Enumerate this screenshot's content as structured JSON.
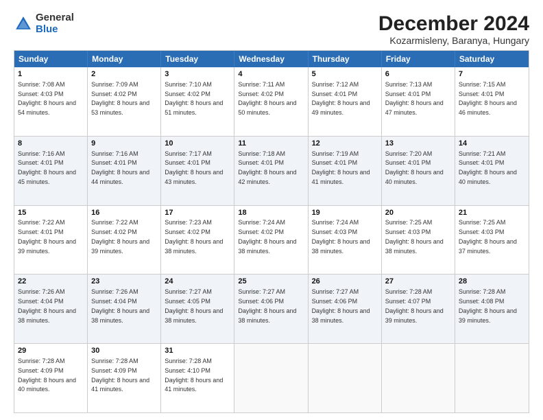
{
  "header": {
    "logo_general": "General",
    "logo_blue": "Blue",
    "title": "December 2024",
    "subtitle": "Kozarmisleny, Baranya, Hungary"
  },
  "days": [
    "Sunday",
    "Monday",
    "Tuesday",
    "Wednesday",
    "Thursday",
    "Friday",
    "Saturday"
  ],
  "rows": [
    [
      {
        "day": "1",
        "sunrise": "Sunrise: 7:08 AM",
        "sunset": "Sunset: 4:03 PM",
        "daylight": "Daylight: 8 hours and 54 minutes."
      },
      {
        "day": "2",
        "sunrise": "Sunrise: 7:09 AM",
        "sunset": "Sunset: 4:02 PM",
        "daylight": "Daylight: 8 hours and 53 minutes."
      },
      {
        "day": "3",
        "sunrise": "Sunrise: 7:10 AM",
        "sunset": "Sunset: 4:02 PM",
        "daylight": "Daylight: 8 hours and 51 minutes."
      },
      {
        "day": "4",
        "sunrise": "Sunrise: 7:11 AM",
        "sunset": "Sunset: 4:02 PM",
        "daylight": "Daylight: 8 hours and 50 minutes."
      },
      {
        "day": "5",
        "sunrise": "Sunrise: 7:12 AM",
        "sunset": "Sunset: 4:01 PM",
        "daylight": "Daylight: 8 hours and 49 minutes."
      },
      {
        "day": "6",
        "sunrise": "Sunrise: 7:13 AM",
        "sunset": "Sunset: 4:01 PM",
        "daylight": "Daylight: 8 hours and 47 minutes."
      },
      {
        "day": "7",
        "sunrise": "Sunrise: 7:15 AM",
        "sunset": "Sunset: 4:01 PM",
        "daylight": "Daylight: 8 hours and 46 minutes."
      }
    ],
    [
      {
        "day": "8",
        "sunrise": "Sunrise: 7:16 AM",
        "sunset": "Sunset: 4:01 PM",
        "daylight": "Daylight: 8 hours and 45 minutes."
      },
      {
        "day": "9",
        "sunrise": "Sunrise: 7:16 AM",
        "sunset": "Sunset: 4:01 PM",
        "daylight": "Daylight: 8 hours and 44 minutes."
      },
      {
        "day": "10",
        "sunrise": "Sunrise: 7:17 AM",
        "sunset": "Sunset: 4:01 PM",
        "daylight": "Daylight: 8 hours and 43 minutes."
      },
      {
        "day": "11",
        "sunrise": "Sunrise: 7:18 AM",
        "sunset": "Sunset: 4:01 PM",
        "daylight": "Daylight: 8 hours and 42 minutes."
      },
      {
        "day": "12",
        "sunrise": "Sunrise: 7:19 AM",
        "sunset": "Sunset: 4:01 PM",
        "daylight": "Daylight: 8 hours and 41 minutes."
      },
      {
        "day": "13",
        "sunrise": "Sunrise: 7:20 AM",
        "sunset": "Sunset: 4:01 PM",
        "daylight": "Daylight: 8 hours and 40 minutes."
      },
      {
        "day": "14",
        "sunrise": "Sunrise: 7:21 AM",
        "sunset": "Sunset: 4:01 PM",
        "daylight": "Daylight: 8 hours and 40 minutes."
      }
    ],
    [
      {
        "day": "15",
        "sunrise": "Sunrise: 7:22 AM",
        "sunset": "Sunset: 4:01 PM",
        "daylight": "Daylight: 8 hours and 39 minutes."
      },
      {
        "day": "16",
        "sunrise": "Sunrise: 7:22 AM",
        "sunset": "Sunset: 4:02 PM",
        "daylight": "Daylight: 8 hours and 39 minutes."
      },
      {
        "day": "17",
        "sunrise": "Sunrise: 7:23 AM",
        "sunset": "Sunset: 4:02 PM",
        "daylight": "Daylight: 8 hours and 38 minutes."
      },
      {
        "day": "18",
        "sunrise": "Sunrise: 7:24 AM",
        "sunset": "Sunset: 4:02 PM",
        "daylight": "Daylight: 8 hours and 38 minutes."
      },
      {
        "day": "19",
        "sunrise": "Sunrise: 7:24 AM",
        "sunset": "Sunset: 4:03 PM",
        "daylight": "Daylight: 8 hours and 38 minutes."
      },
      {
        "day": "20",
        "sunrise": "Sunrise: 7:25 AM",
        "sunset": "Sunset: 4:03 PM",
        "daylight": "Daylight: 8 hours and 38 minutes."
      },
      {
        "day": "21",
        "sunrise": "Sunrise: 7:25 AM",
        "sunset": "Sunset: 4:03 PM",
        "daylight": "Daylight: 8 hours and 37 minutes."
      }
    ],
    [
      {
        "day": "22",
        "sunrise": "Sunrise: 7:26 AM",
        "sunset": "Sunset: 4:04 PM",
        "daylight": "Daylight: 8 hours and 38 minutes."
      },
      {
        "day": "23",
        "sunrise": "Sunrise: 7:26 AM",
        "sunset": "Sunset: 4:04 PM",
        "daylight": "Daylight: 8 hours and 38 minutes."
      },
      {
        "day": "24",
        "sunrise": "Sunrise: 7:27 AM",
        "sunset": "Sunset: 4:05 PM",
        "daylight": "Daylight: 8 hours and 38 minutes."
      },
      {
        "day": "25",
        "sunrise": "Sunrise: 7:27 AM",
        "sunset": "Sunset: 4:06 PM",
        "daylight": "Daylight: 8 hours and 38 minutes."
      },
      {
        "day": "26",
        "sunrise": "Sunrise: 7:27 AM",
        "sunset": "Sunset: 4:06 PM",
        "daylight": "Daylight: 8 hours and 38 minutes."
      },
      {
        "day": "27",
        "sunrise": "Sunrise: 7:28 AM",
        "sunset": "Sunset: 4:07 PM",
        "daylight": "Daylight: 8 hours and 39 minutes."
      },
      {
        "day": "28",
        "sunrise": "Sunrise: 7:28 AM",
        "sunset": "Sunset: 4:08 PM",
        "daylight": "Daylight: 8 hours and 39 minutes."
      }
    ],
    [
      {
        "day": "29",
        "sunrise": "Sunrise: 7:28 AM",
        "sunset": "Sunset: 4:09 PM",
        "daylight": "Daylight: 8 hours and 40 minutes."
      },
      {
        "day": "30",
        "sunrise": "Sunrise: 7:28 AM",
        "sunset": "Sunset: 4:09 PM",
        "daylight": "Daylight: 8 hours and 41 minutes."
      },
      {
        "day": "31",
        "sunrise": "Sunrise: 7:28 AM",
        "sunset": "Sunset: 4:10 PM",
        "daylight": "Daylight: 8 hours and 41 minutes."
      },
      null,
      null,
      null,
      null
    ]
  ],
  "alt_rows": [
    1,
    3
  ]
}
